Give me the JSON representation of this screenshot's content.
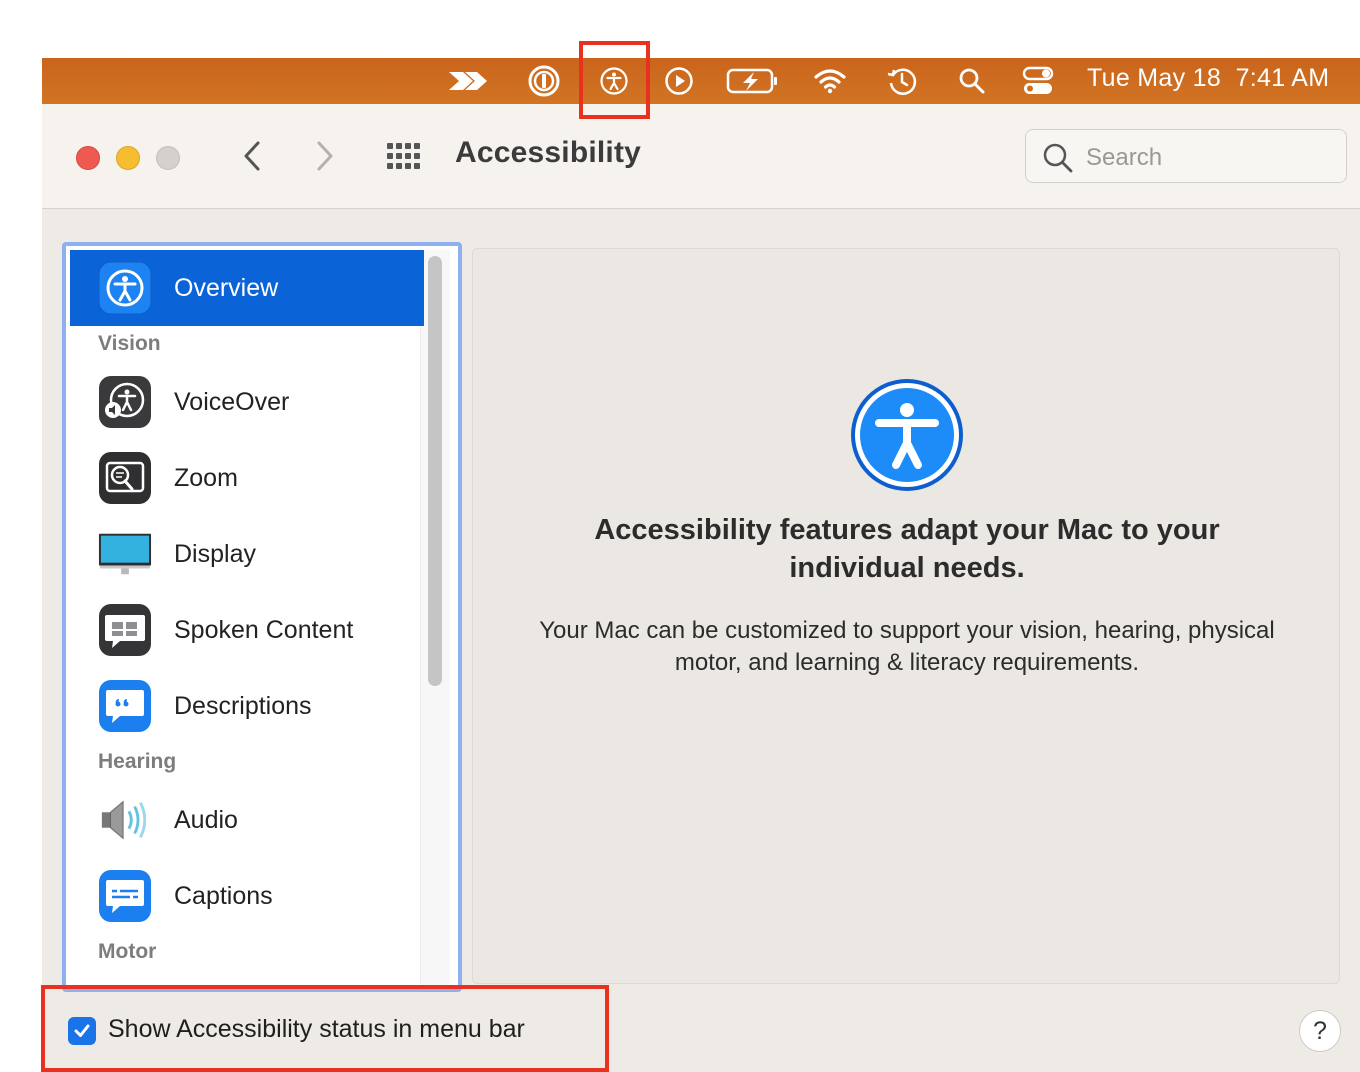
{
  "menubar": {
    "clock": "Tue May 18  7:41 AM",
    "icons": [
      "arrow-forward-icon",
      "onepassword-icon",
      "accessibility-icon",
      "play-icon",
      "battery-charging-icon",
      "wifi-icon",
      "time-machine-icon",
      "spotlight-search-icon",
      "control-center-icon"
    ],
    "background": "#cd6c20"
  },
  "window": {
    "title": "Accessibility",
    "search_placeholder": "Search"
  },
  "sidebar": {
    "selected_label": "Overview",
    "sections": {
      "vision": "Vision",
      "hearing": "Hearing",
      "motor": "Motor"
    },
    "items": [
      {
        "label": "Overview",
        "icon": "accessibility-icon"
      },
      {
        "label": "VoiceOver",
        "icon": "voiceover-icon"
      },
      {
        "label": "Zoom",
        "icon": "zoom-icon"
      },
      {
        "label": "Display",
        "icon": "display-icon"
      },
      {
        "label": "Spoken Content",
        "icon": "spoken-content-icon"
      },
      {
        "label": "Descriptions",
        "icon": "descriptions-icon"
      },
      {
        "label": "Audio",
        "icon": "speaker-icon"
      },
      {
        "label": "Captions",
        "icon": "captions-icon"
      }
    ],
    "accent": "#0b63d8"
  },
  "main": {
    "headline": "Accessibility features adapt your Mac to your individual needs.",
    "body": "Your Mac can be customized to support your vision, hearing, physical motor, and learning & literacy requirements."
  },
  "footer": {
    "checkbox_label": "Show Accessibility status in menu bar",
    "checkbox_checked": true,
    "help_label": "?"
  },
  "annotation_color": "#e8321f"
}
